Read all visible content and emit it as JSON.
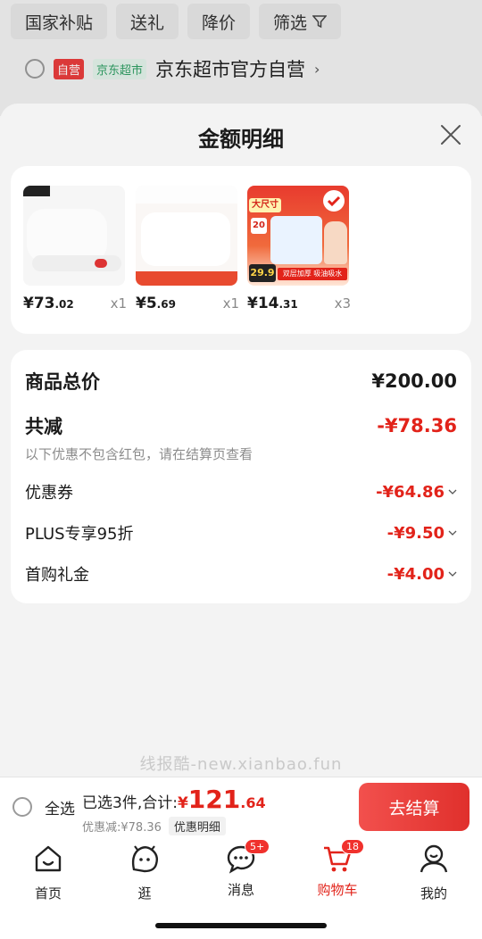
{
  "background": {
    "filters": [
      "国家补贴",
      "送礼",
      "降价",
      "筛选"
    ],
    "store": {
      "tag_self": "自营",
      "tag_market": "京东超市",
      "name": "京东超市官方自营",
      "chevron": "›"
    }
  },
  "sheet": {
    "title": "金额明细",
    "products": [
      {
        "price_main": "¥73",
        "price_dec": ".02",
        "qty": "x1"
      },
      {
        "price_main": "¥5",
        "price_dec": ".69",
        "qty": "x1"
      },
      {
        "price_main": "¥14",
        "price_dec": ".31",
        "qty": "x3"
      }
    ],
    "product3_art": {
      "tag": "大尺寸",
      "roll_count": "20",
      "price_badge": "29.9",
      "caption": "双层加厚 吸油吸水"
    },
    "details": {
      "total_label": "商品总价",
      "total_value": "¥200.00",
      "reduction_label": "共减",
      "reduction_value": "-¥78.36",
      "note": "以下优惠不包含红包，请在结算页查看",
      "items": [
        {
          "label": "优惠券",
          "value": "-¥64.86"
        },
        {
          "label": "PLUS专享95折",
          "value": "-¥9.50"
        },
        {
          "label": "首购礼金",
          "value": "-¥4.00"
        }
      ]
    }
  },
  "watermark": "线报酷-new.xianbao.fun",
  "checkout": {
    "select_all": "全选",
    "summary_label": "已选3件,合计:",
    "currency": "¥",
    "amount_int": "121",
    "amount_dec": ".64",
    "discount_text": "优惠减:¥78.36",
    "detail_link": "优惠明细",
    "pay_button": "去结算"
  },
  "tabbar": [
    {
      "label": "首页",
      "icon": "home-icon"
    },
    {
      "label": "逛",
      "icon": "browse-icon"
    },
    {
      "label": "消息",
      "icon": "message-icon",
      "badge": "5+"
    },
    {
      "label": "购物车",
      "icon": "cart-icon",
      "badge": "18",
      "active": true
    },
    {
      "label": "我的",
      "icon": "profile-icon"
    }
  ],
  "colors": {
    "accent": "#e2231a",
    "pay_button": "#e8403c"
  }
}
